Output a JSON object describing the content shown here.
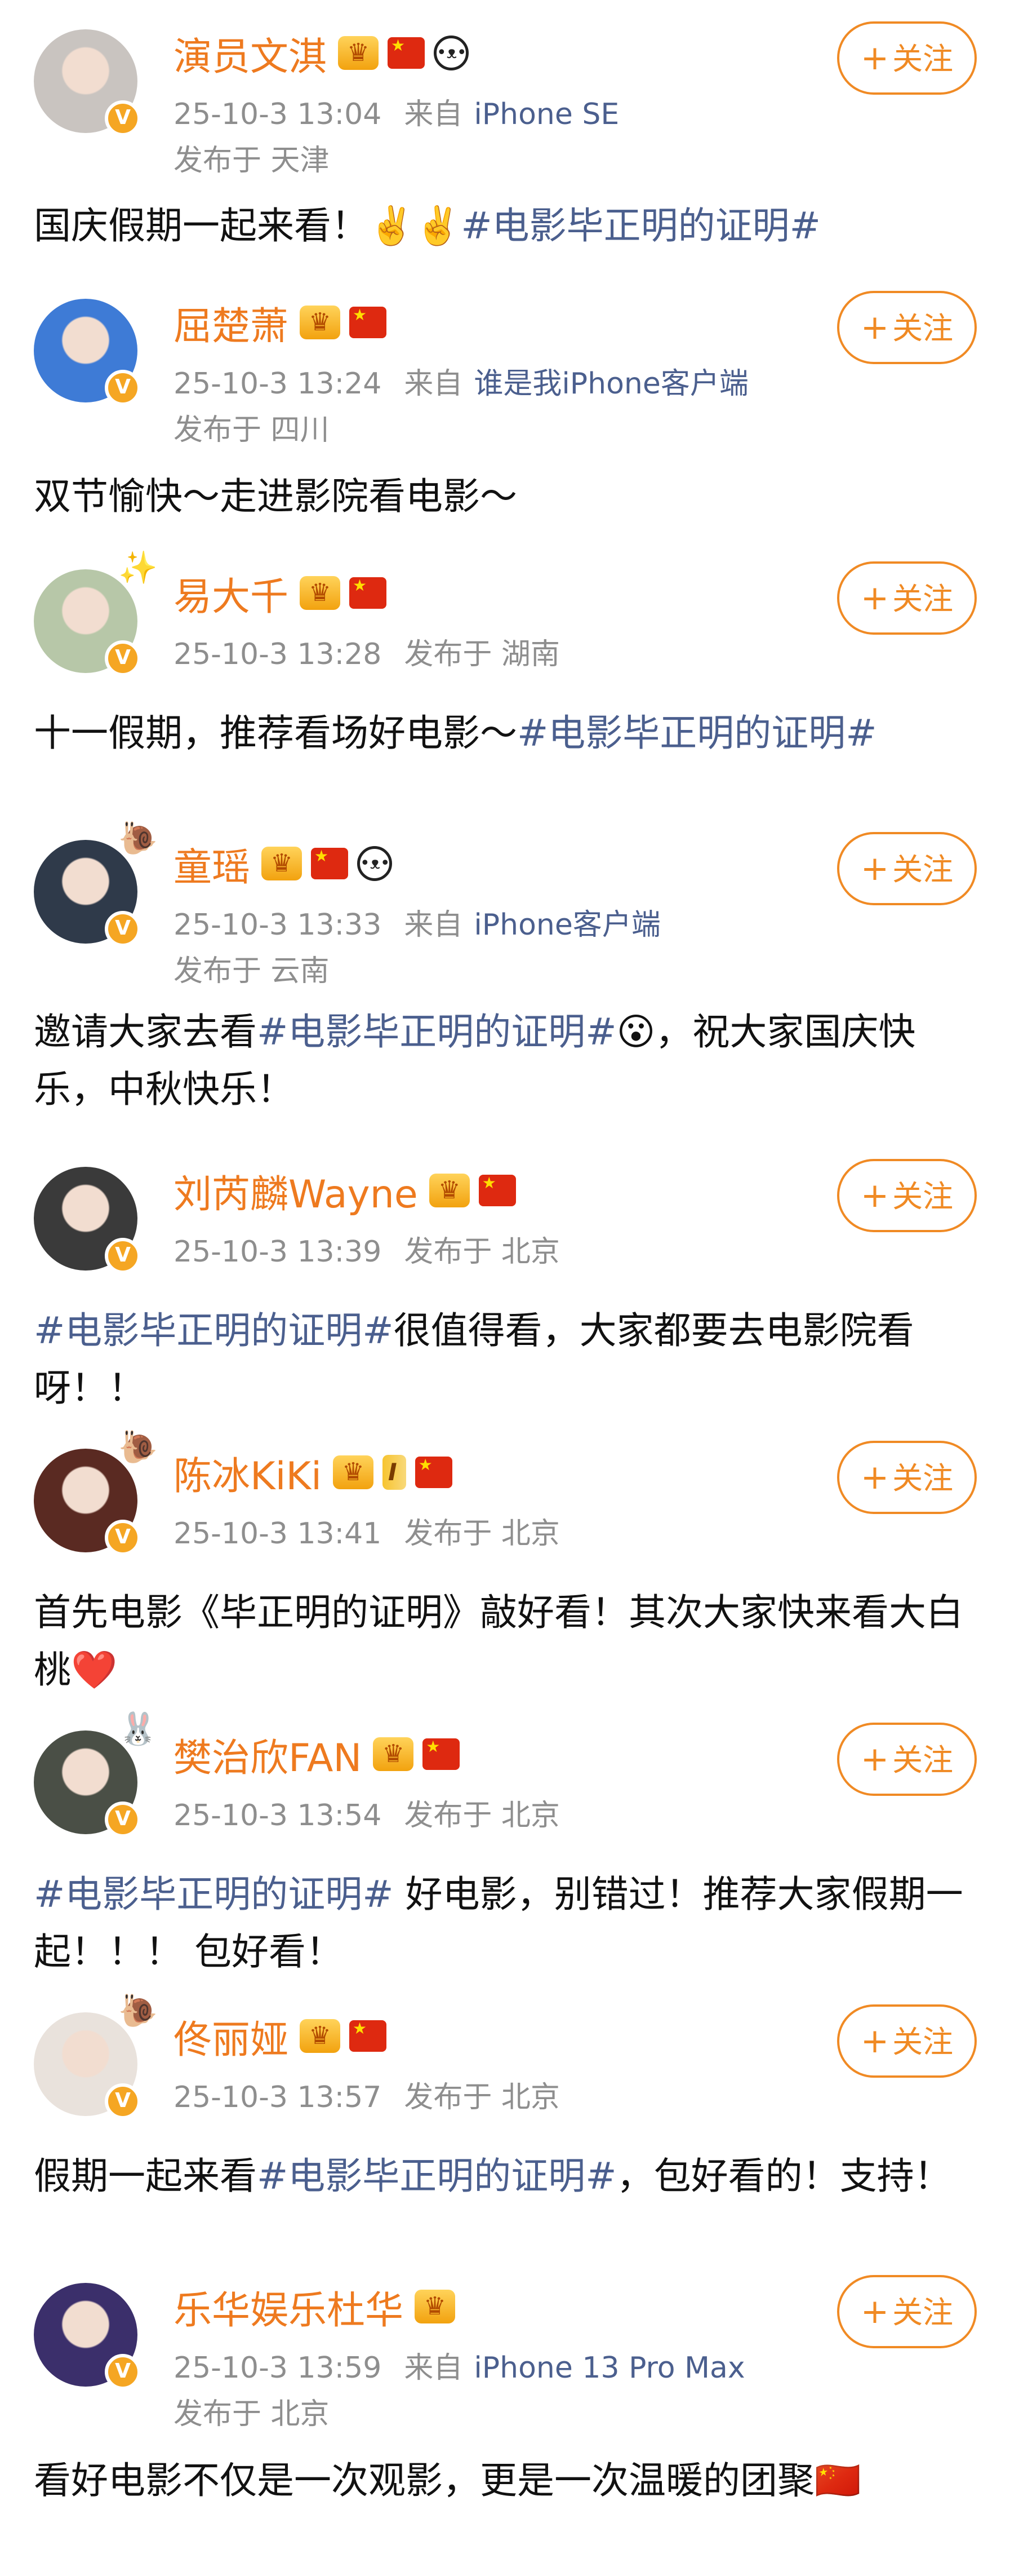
{
  "posts": [
    {
      "name": "演员文淇",
      "badges": [
        "crown",
        "flag",
        "panda"
      ],
      "time": "25-10-3 13:04",
      "via": "来自",
      "source": "iPhone SE",
      "location": "发布于 天津",
      "follow": "关注",
      "text_pre": "国庆假期一起来看！✌️✌️",
      "tag": "#电影毕正明的证明#",
      "text_post": "",
      "avatar_color": "#c9c4c0",
      "deco": ""
    },
    {
      "name": "屈楚萧",
      "badges": [
        "crown",
        "flag"
      ],
      "time": "25-10-3 13:24",
      "via": "来自",
      "source": "谁是我iPhone客户端",
      "location": "发布于 四川",
      "follow": "关注",
      "text_pre": "双节愉快～走进影院看电影～",
      "tag": "",
      "text_post": "",
      "avatar_color": "#3e7bd6",
      "deco": ""
    },
    {
      "name": "易大千",
      "badges": [
        "crown",
        "flag"
      ],
      "time": "25-10-3 13:28",
      "via": "",
      "source": "",
      "location": "发布于 湖南",
      "follow": "关注",
      "text_pre": "十一假期，推荐看场好电影～",
      "tag": "#电影毕正明的证明#",
      "text_post": "",
      "avatar_color": "#b7c7a8",
      "deco": "✨"
    },
    {
      "name": "童瑶",
      "badges": [
        "crown",
        "flag",
        "panda"
      ],
      "time": "25-10-3 13:33",
      "via": "来自",
      "source": "iPhone客户端",
      "location": "发布于 云南",
      "follow": "关注",
      "text_pre": "邀请大家去看",
      "tag": "#电影毕正明的证明#",
      "text_post": "😮，祝大家国庆快乐，中秋快乐！",
      "avatar_color": "#2f3a4a",
      "deco": "🐌"
    },
    {
      "name": "刘芮麟Wayne",
      "badges": [
        "crown",
        "flag"
      ],
      "time": "25-10-3 13:39",
      "via": "",
      "source": "",
      "location": "发布于 北京",
      "follow": "关注",
      "text_pre": "",
      "tag": "#电影毕正明的证明#",
      "text_post": "很值得看，大家都要去电影院看呀！！",
      "avatar_color": "#3a3a3a",
      "deco": ""
    },
    {
      "name": "陈冰KiKi",
      "badges": [
        "crown-level",
        "flag"
      ],
      "level": "I",
      "time": "25-10-3 13:41",
      "via": "",
      "source": "",
      "location": "发布于 北京",
      "follow": "关注",
      "text_pre": "首先电影《毕正明的证明》敲好看！其次大家快来看大白桃❤️",
      "tag": "",
      "text_post": "",
      "avatar_color": "#5a2a22",
      "deco": "🐌"
    },
    {
      "name": "樊治欣FAN",
      "badges": [
        "crown",
        "flag"
      ],
      "time": "25-10-3 13:54",
      "via": "",
      "source": "",
      "location": "发布于 北京",
      "follow": "关注",
      "text_pre": "",
      "tag": "#电影毕正明的证明#",
      "text_post": " 好电影，别错过！推荐大家假期一起！！！ 包好看！",
      "avatar_color": "#4a4f46",
      "deco": "🐰"
    },
    {
      "name": "佟丽娅",
      "badges": [
        "crown",
        "flag"
      ],
      "time": "25-10-3 13:57",
      "via": "",
      "source": "",
      "location": "发布于 北京",
      "follow": "关注",
      "text_pre": "假期一起来看",
      "tag": "#电影毕正明的证明#",
      "text_post": "，包好看的！支持！",
      "avatar_color": "#e9e2dc",
      "deco": "🐌"
    },
    {
      "name": "乐华娱乐杜华",
      "badges": [
        "crown"
      ],
      "time": "25-10-3 13:59",
      "via": "来自",
      "source": "iPhone 13 Pro Max",
      "location": "发布于 北京",
      "follow": "关注",
      "text_pre": "看好电影不仅是一次观影，更是一次温暖的团聚🇨🇳",
      "tag": "",
      "text_post": "",
      "avatar_color": "#3b2f6b",
      "deco": ""
    }
  ],
  "colors": {
    "name": "#ee7a1f",
    "meta": "#8e8e8e",
    "link": "#4b5f8e",
    "follow": "#f08a24"
  }
}
